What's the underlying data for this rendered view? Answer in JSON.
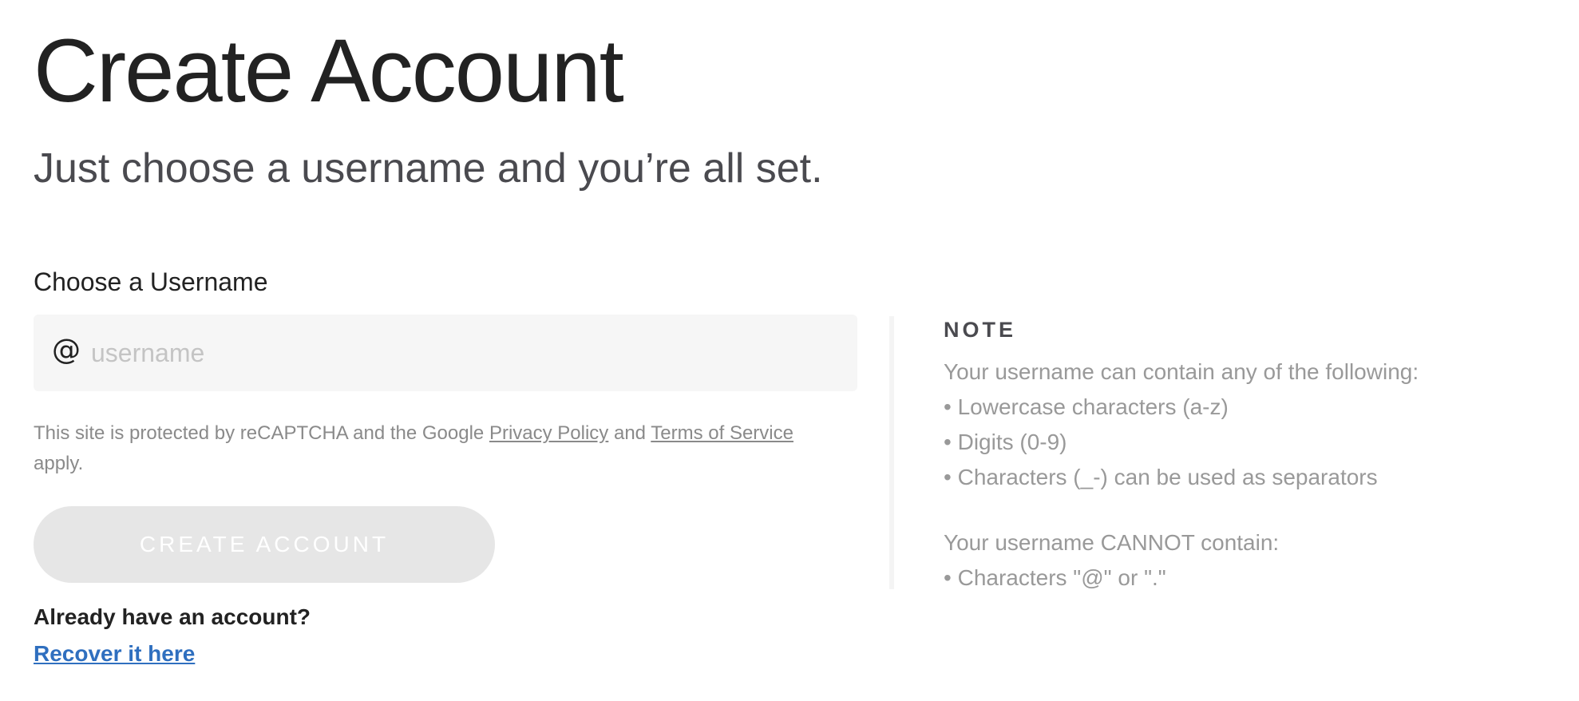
{
  "header": {
    "title": "Create Account",
    "subtitle": "Just choose a username and you’re all set."
  },
  "form": {
    "username_label": "Choose a Username",
    "username_prefix_icon": "at-icon",
    "username_prefix_glyph": "@",
    "username_placeholder": "username",
    "username_value": "",
    "legal_prefix": "This site is protected by reCAPTCHA and the Google ",
    "privacy_link": "Privacy Policy",
    "legal_and": " and ",
    "terms_link": "Terms of Service",
    "legal_suffix": " apply.",
    "submit_label": "CREATE ACCOUNT",
    "submit_disabled": true
  },
  "recover": {
    "prompt": "Already have an account?",
    "link_label": "Recover it here"
  },
  "note": {
    "heading": "NOTE",
    "allowed_intro": "Your username can contain any of the following:",
    "allowed": [
      "Lowercase characters (a-z)",
      "Digits (0-9)",
      "Characters (_-) can be used as separators"
    ],
    "disallowed_intro": "Your username CANNOT contain:",
    "disallowed": [
      "Characters \"@\" or \".\""
    ]
  },
  "colors": {
    "title": "#222222",
    "subtitle": "#4a4a4f",
    "input_bg": "#f6f6f6",
    "muted_text": "#8a8a8a",
    "note_text": "#999999",
    "button_bg_disabled": "#e6e6e6",
    "link": "#2f6fbf"
  }
}
